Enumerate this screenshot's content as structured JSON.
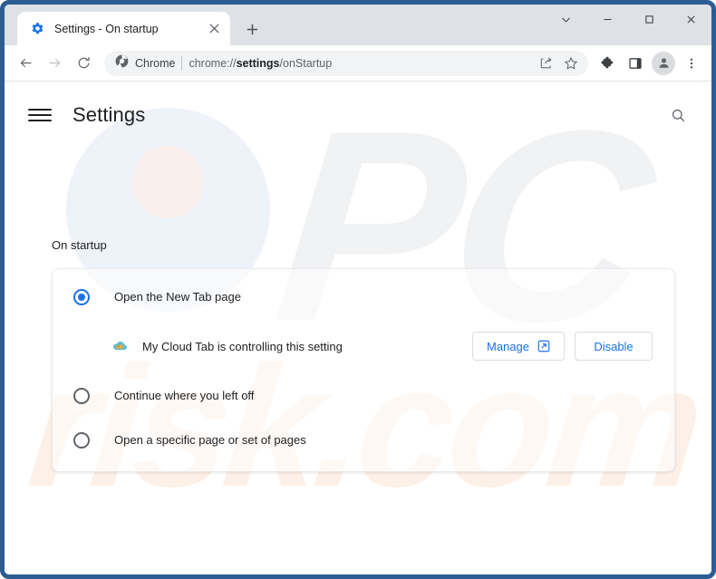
{
  "window": {
    "frame_color": "#2c5d92",
    "caption_buttons": [
      {
        "name": "chevron-down-icon",
        "label": ""
      },
      {
        "name": "minimize-icon",
        "label": ""
      },
      {
        "name": "maximize-icon",
        "label": ""
      },
      {
        "name": "close-icon",
        "label": ""
      }
    ]
  },
  "tabstrip": {
    "tabs": [
      {
        "title": "Settings - On startup",
        "favicon": "gear-icon",
        "close": "close-icon"
      }
    ],
    "new_tab_label": "+"
  },
  "toolbar": {
    "back_icon": "back-arrow-icon",
    "forward_icon": "forward-arrow-icon",
    "reload_icon": "reload-icon",
    "chip_label": "Chrome",
    "chip_icon": "chrome-logo-icon",
    "url_prefix": "chrome://",
    "url_bold": "settings",
    "url_suffix": "/onStartup",
    "url_full": "chrome://settings/onStartup",
    "share_icon": "share-icon",
    "bookmark_icon": "star-icon",
    "extensions_icon": "puzzle-piece-icon",
    "sidepanel_icon": "side-panel-icon",
    "profile_icon": "person-avatar-icon",
    "menu_icon": "three-dot-menu-icon"
  },
  "settings_page": {
    "menu_icon": "hamburger-menu-icon",
    "title": "Settings",
    "search_icon": "search-icon",
    "section_label": "On startup",
    "options": [
      {
        "label": "Open the New Tab page",
        "checked": true
      },
      {
        "label": "Continue where you left off",
        "checked": false
      },
      {
        "label": "Open a specific page or set of pages",
        "checked": false
      }
    ],
    "extension_notice": {
      "icon": "cloud-extension-icon",
      "text": "My Cloud Tab is controlling this setting",
      "manage_label": "Manage",
      "manage_icon": "external-link-icon",
      "disable_label": "Disable"
    }
  },
  "watermark": {
    "primary": "PC",
    "secondary": "risk.com",
    "primary_color": "#f1f2f4",
    "secondary_color": "#fdf0e6"
  },
  "colors": {
    "accent": "#1a73e8",
    "text": "#202124",
    "muted": "#5f6368",
    "tabstrip_bg": "#dee1e6",
    "omnibox_bg": "#f1f3f4"
  }
}
